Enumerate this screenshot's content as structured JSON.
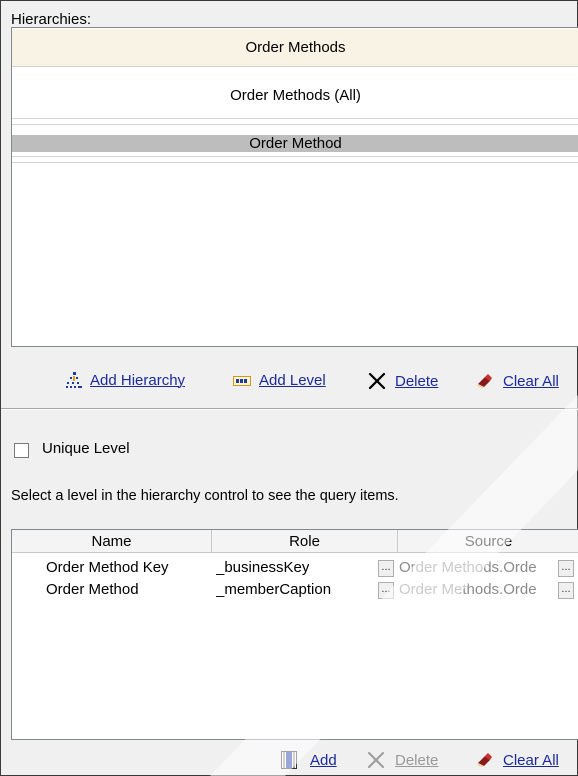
{
  "hierarchies": {
    "label": "Hierarchies:",
    "root": "Order Methods",
    "levels": [
      "Order Methods (All)",
      "Order Method"
    ]
  },
  "hierarchy_toolbar": {
    "add_hierarchy": "Add Hierarchy",
    "add_level": "Add Level",
    "delete": "Delete",
    "clear_all": "Clear All"
  },
  "unique_level": {
    "label": "Unique Level",
    "checked": false
  },
  "info_text": "Select a level in the hierarchy control to see the query items.",
  "grid": {
    "columns": [
      "Name",
      "Role",
      "Source"
    ],
    "rows": [
      {
        "name": "Order Method Key",
        "role": "_businessKey",
        "source": "Order Methods.Orde"
      },
      {
        "name": "Order Method",
        "role": "_memberCaption",
        "source": "Order Methods.Orde"
      }
    ],
    "ellipsis": "..."
  },
  "grid_toolbar": {
    "add": "Add",
    "delete": "Delete",
    "clear_all": "Clear All"
  }
}
